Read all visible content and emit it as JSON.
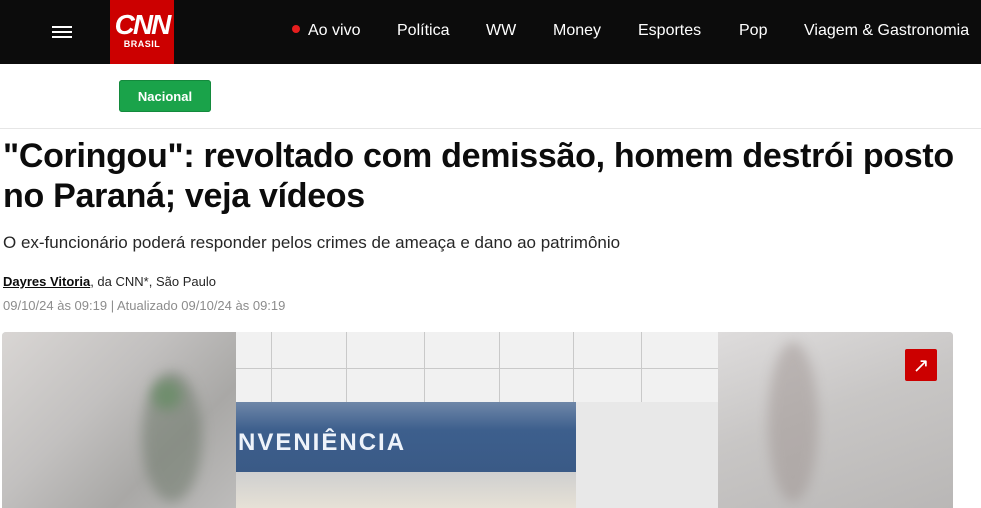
{
  "header": {
    "logo_text": "CNN",
    "logo_subtext": "BRASIL",
    "nav": [
      {
        "label": "Ao vivo",
        "live": true
      },
      {
        "label": "Política"
      },
      {
        "label": "WW"
      },
      {
        "label": "Money"
      },
      {
        "label": "Esportes"
      },
      {
        "label": "Pop"
      },
      {
        "label": "Viagem & Gastronomia"
      }
    ],
    "menu_icon": "hamburger-icon"
  },
  "section_tag": "Nacional",
  "article": {
    "headline": "\"Coringou\": revoltado com demissão, homem destrói posto no Paraná; veja vídeos",
    "subtitle": "O ex-funcionário poderá responder pelos crimes de ameaça e dano ao patrimônio",
    "author": "Dayres Vitoria",
    "byline_rest": ", da CNN*, São Paulo",
    "dates": "09/10/24 às 09:19 | Atualizado 09/10/24 às 09:19"
  },
  "media": {
    "sign_text": "NVENIÊNCIA",
    "expand_icon": "expand-arrow-icon"
  },
  "colors": {
    "brand_red": "#cc0000",
    "tag_green": "#1aa34a",
    "topbar": "#0c0c0c",
    "live_dot": "#e61e1e"
  }
}
